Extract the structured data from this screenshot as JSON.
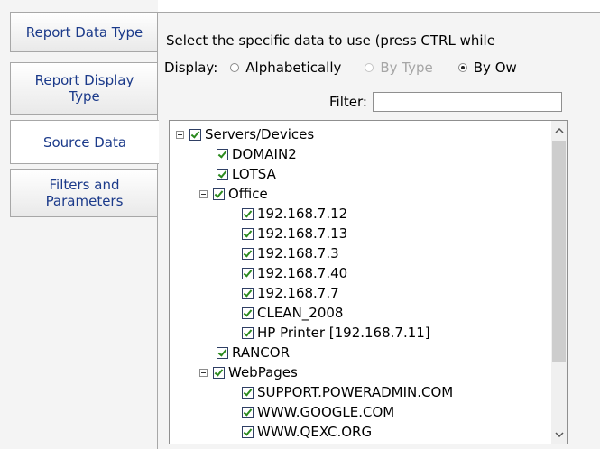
{
  "tabs": [
    {
      "label": "Report Data Type",
      "active": false
    },
    {
      "label": "Report Display Type",
      "active": false
    },
    {
      "label": "Source Data",
      "active": true
    },
    {
      "label": "Filters and Parameters",
      "active": false
    }
  ],
  "instruction": "Select the specific data to use (press CTRL while",
  "display": {
    "label": "Display:",
    "options": [
      {
        "label": "Alphabetically",
        "checked": false,
        "disabled": false
      },
      {
        "label": "By Type",
        "checked": false,
        "disabled": true
      },
      {
        "label": "By Ow",
        "checked": true,
        "disabled": false
      }
    ]
  },
  "filter": {
    "label": "Filter:",
    "value": ""
  },
  "tree": [
    {
      "label": "Servers/Devices",
      "checked": true,
      "expander": true
    },
    {
      "label": "DOMAIN2",
      "checked": true,
      "expander": false
    },
    {
      "label": "LOTSA",
      "checked": true,
      "expander": false
    },
    {
      "label": "Office",
      "checked": true,
      "expander": true
    },
    {
      "label": "192.168.7.12",
      "checked": true,
      "expander": false
    },
    {
      "label": "192.168.7.13",
      "checked": true,
      "expander": false
    },
    {
      "label": "192.168.7.3",
      "checked": true,
      "expander": false
    },
    {
      "label": "192.168.7.40",
      "checked": true,
      "expander": false
    },
    {
      "label": "192.168.7.7",
      "checked": true,
      "expander": false
    },
    {
      "label": "CLEAN_2008",
      "checked": true,
      "expander": false
    },
    {
      "label": "HP Printer [192.168.7.11]",
      "checked": true,
      "expander": false
    },
    {
      "label": "RANCOR",
      "checked": true,
      "expander": false
    },
    {
      "label": "WebPages",
      "checked": true,
      "expander": true
    },
    {
      "label": "SUPPORT.POWERADMIN.COM",
      "checked": true,
      "expander": false
    },
    {
      "label": "WWW.GOOGLE.COM",
      "checked": true,
      "expander": false
    },
    {
      "label": "WWW.QEXC.ORG",
      "checked": true,
      "expander": false
    }
  ],
  "scrollbar": {
    "up_icon": "chevron-up-icon",
    "down_icon": "chevron-down-icon"
  }
}
